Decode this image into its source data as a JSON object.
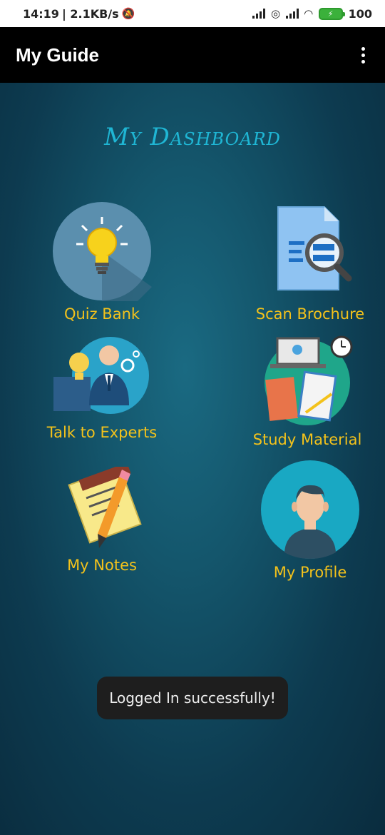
{
  "status_bar": {
    "time": "14:19",
    "net_speed": "| 2.1KB/s",
    "battery": "100"
  },
  "app_bar": {
    "title": "My Guide"
  },
  "dashboard": {
    "title": "My Dashboard",
    "tiles": [
      {
        "label": "Quiz Bank",
        "icon": "lightbulb-icon"
      },
      {
        "label": "Scan Brochure",
        "icon": "document-search-icon"
      },
      {
        "label": "Talk to Experts",
        "icon": "expert-icon"
      },
      {
        "label": "Study Material",
        "icon": "study-material-icon"
      },
      {
        "label": "My Notes",
        "icon": "notes-pencil-icon"
      },
      {
        "label": "My Profile",
        "icon": "profile-avatar-icon"
      }
    ]
  },
  "toast": {
    "message": "Logged In successfully!"
  },
  "colors": {
    "accent_title": "#1fb6d4",
    "tile_label": "#f3c21b",
    "app_bar_bg": "#000000"
  }
}
